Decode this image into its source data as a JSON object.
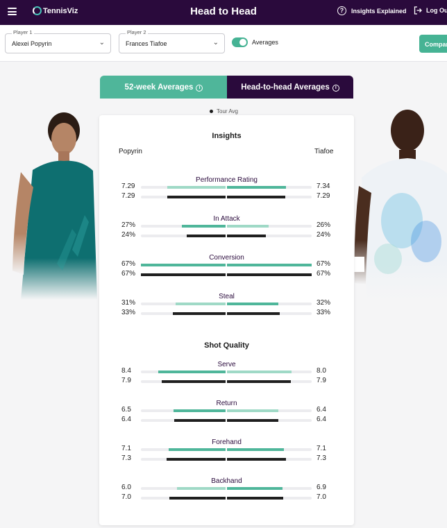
{
  "header": {
    "logo_text": "TennisViz",
    "title": "Head to Head",
    "insights_label": "Insights Explained",
    "logout_label": "Log Out"
  },
  "controls": {
    "player1_label": "Player 1",
    "player1_value": "Alexei Popyrin",
    "player2_label": "Player 2",
    "player2_value": "Frances Tiafoe",
    "averages_label": "Averages",
    "averages_on": true,
    "compare_label": "Compare"
  },
  "tabs": [
    {
      "label": "52-week Averages",
      "active": true
    },
    {
      "label": "Head-to-head Averages",
      "active": false
    }
  ],
  "legend": {
    "tour_avg_label": "Tour Avg"
  },
  "players": {
    "left_name": "Popyrin",
    "right_name": "Tiafoe"
  },
  "colors": {
    "accent_green": "#4fb69a",
    "light_green": "#9fd9c6",
    "brand_purple": "#2a0a3c",
    "tour_avg": "#1f1f1f"
  },
  "sections": [
    {
      "title": "Insights",
      "metrics": [
        {
          "name": "Performance Rating",
          "left": "7.29",
          "right": "7.34",
          "left_avg": "7.29",
          "right_avg": "7.29"
        },
        {
          "name": "In Attack",
          "left": "27%",
          "right": "26%",
          "left_avg": "24%",
          "right_avg": "24%"
        },
        {
          "name": "Conversion",
          "left": "67%",
          "right": "67%",
          "left_avg": "67%",
          "right_avg": "67%"
        },
        {
          "name": "Steal",
          "left": "31%",
          "right": "32%",
          "left_avg": "33%",
          "right_avg": "33%"
        }
      ]
    },
    {
      "title": "Shot Quality",
      "metrics": [
        {
          "name": "Serve",
          "left": "8.4",
          "right": "8.0",
          "left_avg": "7.9",
          "right_avg": "7.9"
        },
        {
          "name": "Return",
          "left": "6.5",
          "right": "6.4",
          "left_avg": "6.4",
          "right_avg": "6.4"
        },
        {
          "name": "Forehand",
          "left": "7.1",
          "right": "7.1",
          "left_avg": "7.3",
          "right_avg": "7.3"
        },
        {
          "name": "Backhand",
          "left": "6.0",
          "right": "6.9",
          "left_avg": "7.0",
          "right_avg": "7.0"
        }
      ]
    }
  ]
}
